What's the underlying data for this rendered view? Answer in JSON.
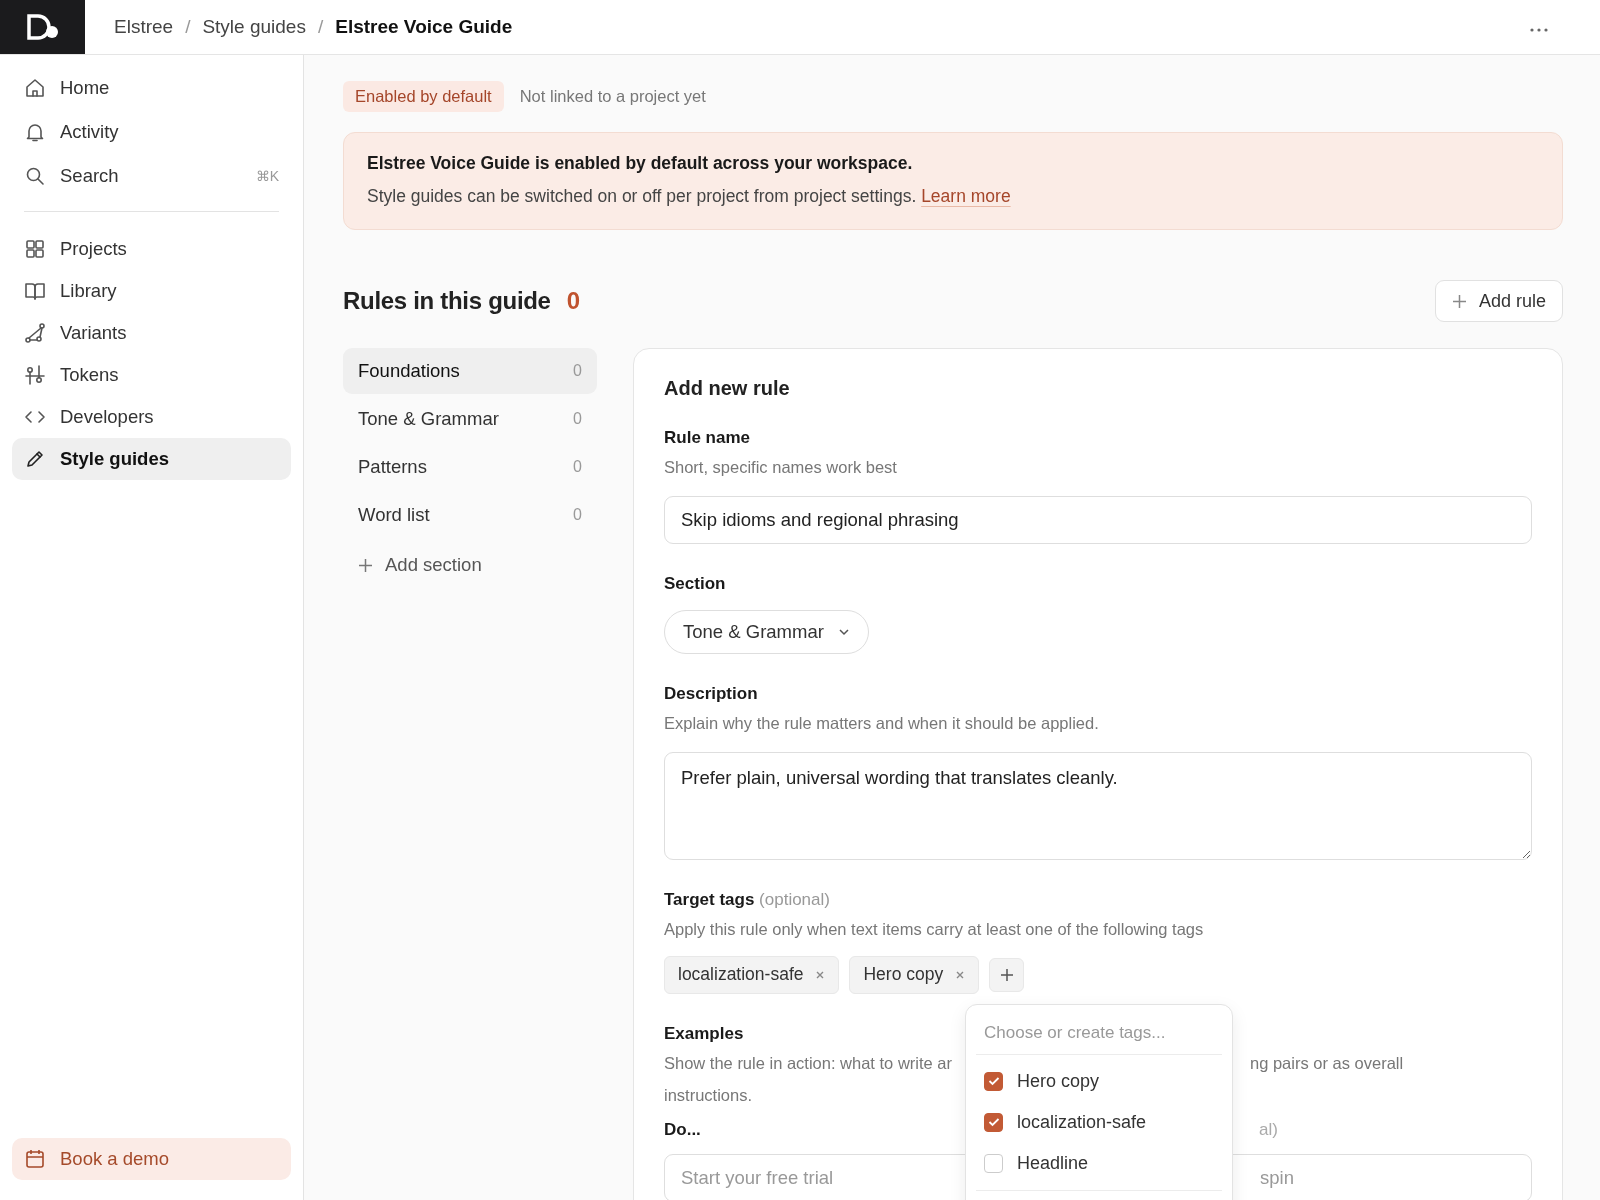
{
  "breadcrumb": [
    {
      "label": "Elstree",
      "current": false
    },
    {
      "label": "Style guides",
      "current": false,
      "separator": "/"
    },
    {
      "label": "Elstree Voice Guide",
      "current": true,
      "separator": "/"
    }
  ],
  "sidebar": {
    "groups": [
      [
        {
          "label": "Home",
          "kind": "home",
          "selected": false
        },
        {
          "label": "Activity",
          "kind": "bell",
          "selected": false
        },
        {
          "label": "Search",
          "kind": "search",
          "selected": false,
          "shortcut": "⌘K"
        }
      ],
      [
        {
          "label": "Projects",
          "kind": "grid",
          "selected": false
        },
        {
          "label": "Library",
          "kind": "book",
          "selected": false
        },
        {
          "label": "Variants",
          "kind": "branch",
          "selected": false
        },
        {
          "label": "Tokens",
          "kind": "sliders",
          "selected": false
        },
        {
          "label": "Developers",
          "kind": "code",
          "selected": false
        },
        {
          "label": "Style guides",
          "kind": "pencil",
          "selected": true
        }
      ]
    ],
    "footer_button": "Book a demo"
  },
  "status": {
    "badge": "Enabled by default",
    "note": "Not linked to a project yet"
  },
  "banner": {
    "title": "Elstree Voice Guide is enabled by default across your workspace.",
    "text": "Style guides can be switched on or off per project from project settings.",
    "link": "Learn more"
  },
  "rules": {
    "title": "Rules in this guide",
    "count": "0",
    "add_button": "Add rule",
    "sections": [
      {
        "label": "Foundations",
        "count": "0",
        "selected": true
      },
      {
        "label": "Tone & Grammar",
        "count": "0",
        "selected": false
      },
      {
        "label": "Patterns",
        "count": "0",
        "selected": false
      },
      {
        "label": "Word list",
        "count": "0",
        "selected": false
      }
    ],
    "add_section": "Add section"
  },
  "form": {
    "title": "Add new rule",
    "rule_name": {
      "label": "Rule name",
      "hint": "Short, specific names work best",
      "value": "Skip idioms and regional phrasing"
    },
    "section": {
      "label": "Section",
      "value": "Tone & Grammar"
    },
    "description": {
      "label": "Description",
      "hint": "Explain why the rule matters and when it should be applied.",
      "value": "Prefer plain, universal wording that translates cleanly."
    },
    "tags": {
      "label": "Target tags",
      "optional": "(optional)",
      "hint": "Apply this rule only when text items carry at least one of the following tags",
      "chips": [
        "localization-safe",
        "Hero copy"
      ]
    },
    "examples": {
      "label": "Examples",
      "hint_left": "Show the rule in action: what to write ar",
      "hint_right": "ng pairs or as overall",
      "hint_line2": "instructions.",
      "do_label": "Do...",
      "dont_label": "al)",
      "do_placeholder": "Start your free trial",
      "dont_placeholder": "spin"
    },
    "popover": {
      "placeholder": "Choose or create tags...",
      "options": [
        {
          "label": "Hero copy",
          "checked": true
        },
        {
          "label": "localization-safe",
          "checked": true
        },
        {
          "label": "Headline",
          "checked": false
        }
      ]
    }
  }
}
